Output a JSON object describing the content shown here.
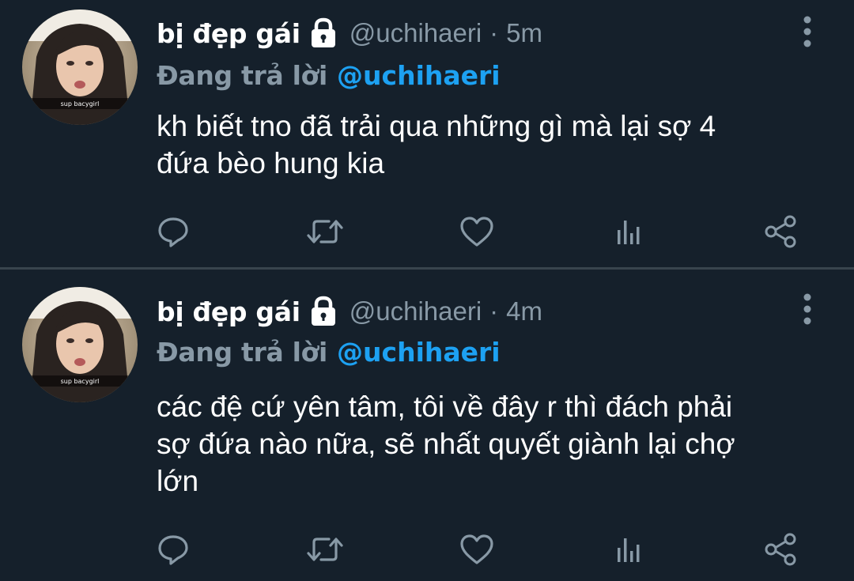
{
  "tweets": [
    {
      "display_name": "bị đẹp gái",
      "handle": "@uchihaeri",
      "separator": "·",
      "time": "5m",
      "reply_prefix": "Đang trả lời",
      "reply_to": "@uchihaeri",
      "avatar_caption": "sup bacygirl",
      "text_lines": [
        "kh biết tno đã trải qua những gì mà lại sợ 4",
        "đứa bèo hung kia"
      ]
    },
    {
      "display_name": "bị đẹp gái",
      "handle": "@uchihaeri",
      "separator": "·",
      "time": "4m",
      "reply_prefix": "Đang trả lời",
      "reply_to": "@uchihaeri",
      "avatar_caption": "sup bacygirl",
      "text_lines": [
        "các đệ cứ yên tâm, tôi về đây r thì đách phải",
        "sợ đứa nào nữa, sẽ nhất quyết giành lại chợ",
        "lớn"
      ]
    }
  ],
  "icons": {
    "lock": "lock-icon",
    "more": "more-vertical-icon",
    "reply": "reply-icon",
    "retweet": "retweet-icon",
    "like": "heart-icon",
    "analytics": "analytics-icon",
    "share": "share-icon"
  },
  "colors": {
    "background": "#15202b",
    "divider": "#38444d",
    "primary_text": "#ffffff",
    "secondary_text": "#8899a6",
    "accent": "#1da1f2"
  }
}
